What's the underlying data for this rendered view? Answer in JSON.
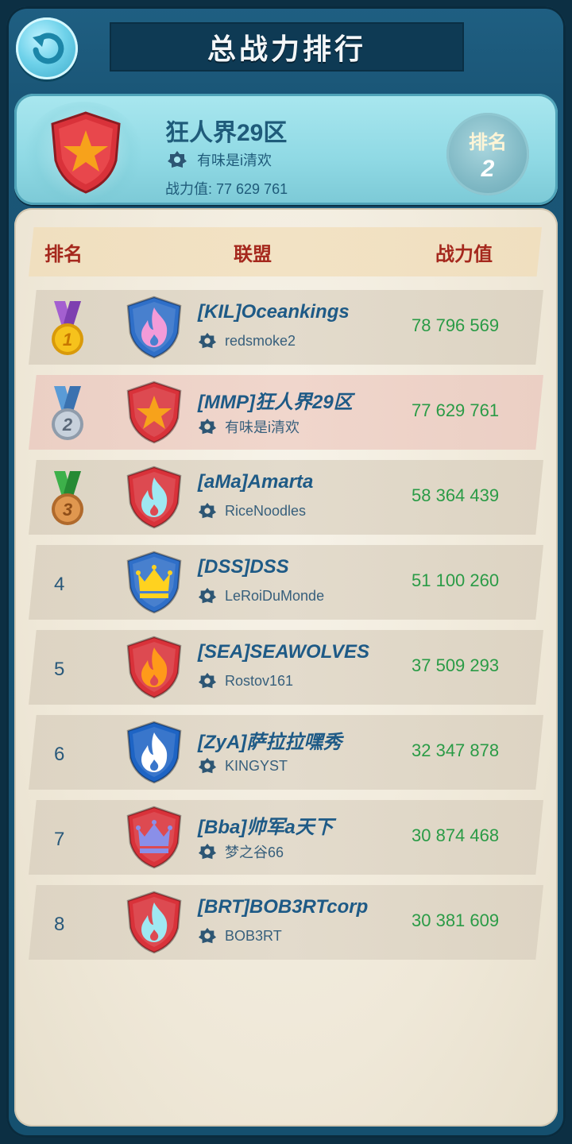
{
  "header": {
    "title": "总战力排行",
    "back_icon": "back-arrow-icon"
  },
  "player": {
    "alliance_name": "狂人界29区",
    "leader": "有味是i清欢",
    "power_label": "战力值: 77 629 761",
    "rank_label": "排名",
    "rank_value": "2",
    "emblem": {
      "color": "#d9323a",
      "icon": "star-icon"
    }
  },
  "table": {
    "columns": [
      "排名",
      "联盟",
      "战力值"
    ],
    "rows": [
      {
        "rank": "1",
        "medal": "gold",
        "name": "[KIL]Oceankings",
        "leader": "redsmoke2",
        "power": "78 796 569",
        "emblem": {
          "color": "#2f6fc8",
          "icon": "flame-icon",
          "icon_color": "#f39bd8"
        }
      },
      {
        "rank": "2",
        "medal": "silver",
        "name": "[MMP]狂人界29区",
        "leader": "有味是i清欢",
        "power": "77 629 761",
        "highlight": true,
        "emblem": {
          "color": "#d9323a",
          "icon": "star-icon",
          "icon_color": "#f7a21b"
        }
      },
      {
        "rank": "3",
        "medal": "bronze",
        "name": "[aMa]Amarta",
        "leader": "RiceNoodles",
        "power": "58 364 439",
        "emblem": {
          "color": "#d9323a",
          "icon": "flame-icon",
          "icon_color": "#9fe8f2"
        }
      },
      {
        "rank": "4",
        "name": "[DSS]DSS",
        "leader": "LeRoiDuMonde",
        "power": "51 100 260",
        "emblem": {
          "color": "#2f6fc8",
          "icon": "crown-icon",
          "icon_color": "#ffd21f"
        }
      },
      {
        "rank": "5",
        "name": "[SEA]SEAWOLVES",
        "leader": "Rostov161",
        "power": "37 509 293",
        "emblem": {
          "color": "#d9323a",
          "icon": "flame-icon",
          "icon_color": "#ff9a1a"
        }
      },
      {
        "rank": "6",
        "name": "[ZyA]萨拉拉嘿秀",
        "leader": "KINGYST",
        "power": "32 347 878",
        "emblem": {
          "color": "#1e64c4",
          "icon": "flame-icon",
          "icon_color": "#ffffff"
        }
      },
      {
        "rank": "7",
        "name": "[Bba]帅军a天下",
        "leader": "梦之谷66",
        "power": "30 874 468",
        "emblem": {
          "color": "#d9323a",
          "icon": "crown-icon",
          "icon_color": "#8a8fe8"
        }
      },
      {
        "rank": "8",
        "name": "[BRT]BOB3RTcorp",
        "leader": "BOB3RT",
        "power": "30 381 609",
        "emblem": {
          "color": "#d9323a",
          "icon": "flame-icon",
          "icon_color": "#9fe8f2"
        }
      }
    ]
  }
}
